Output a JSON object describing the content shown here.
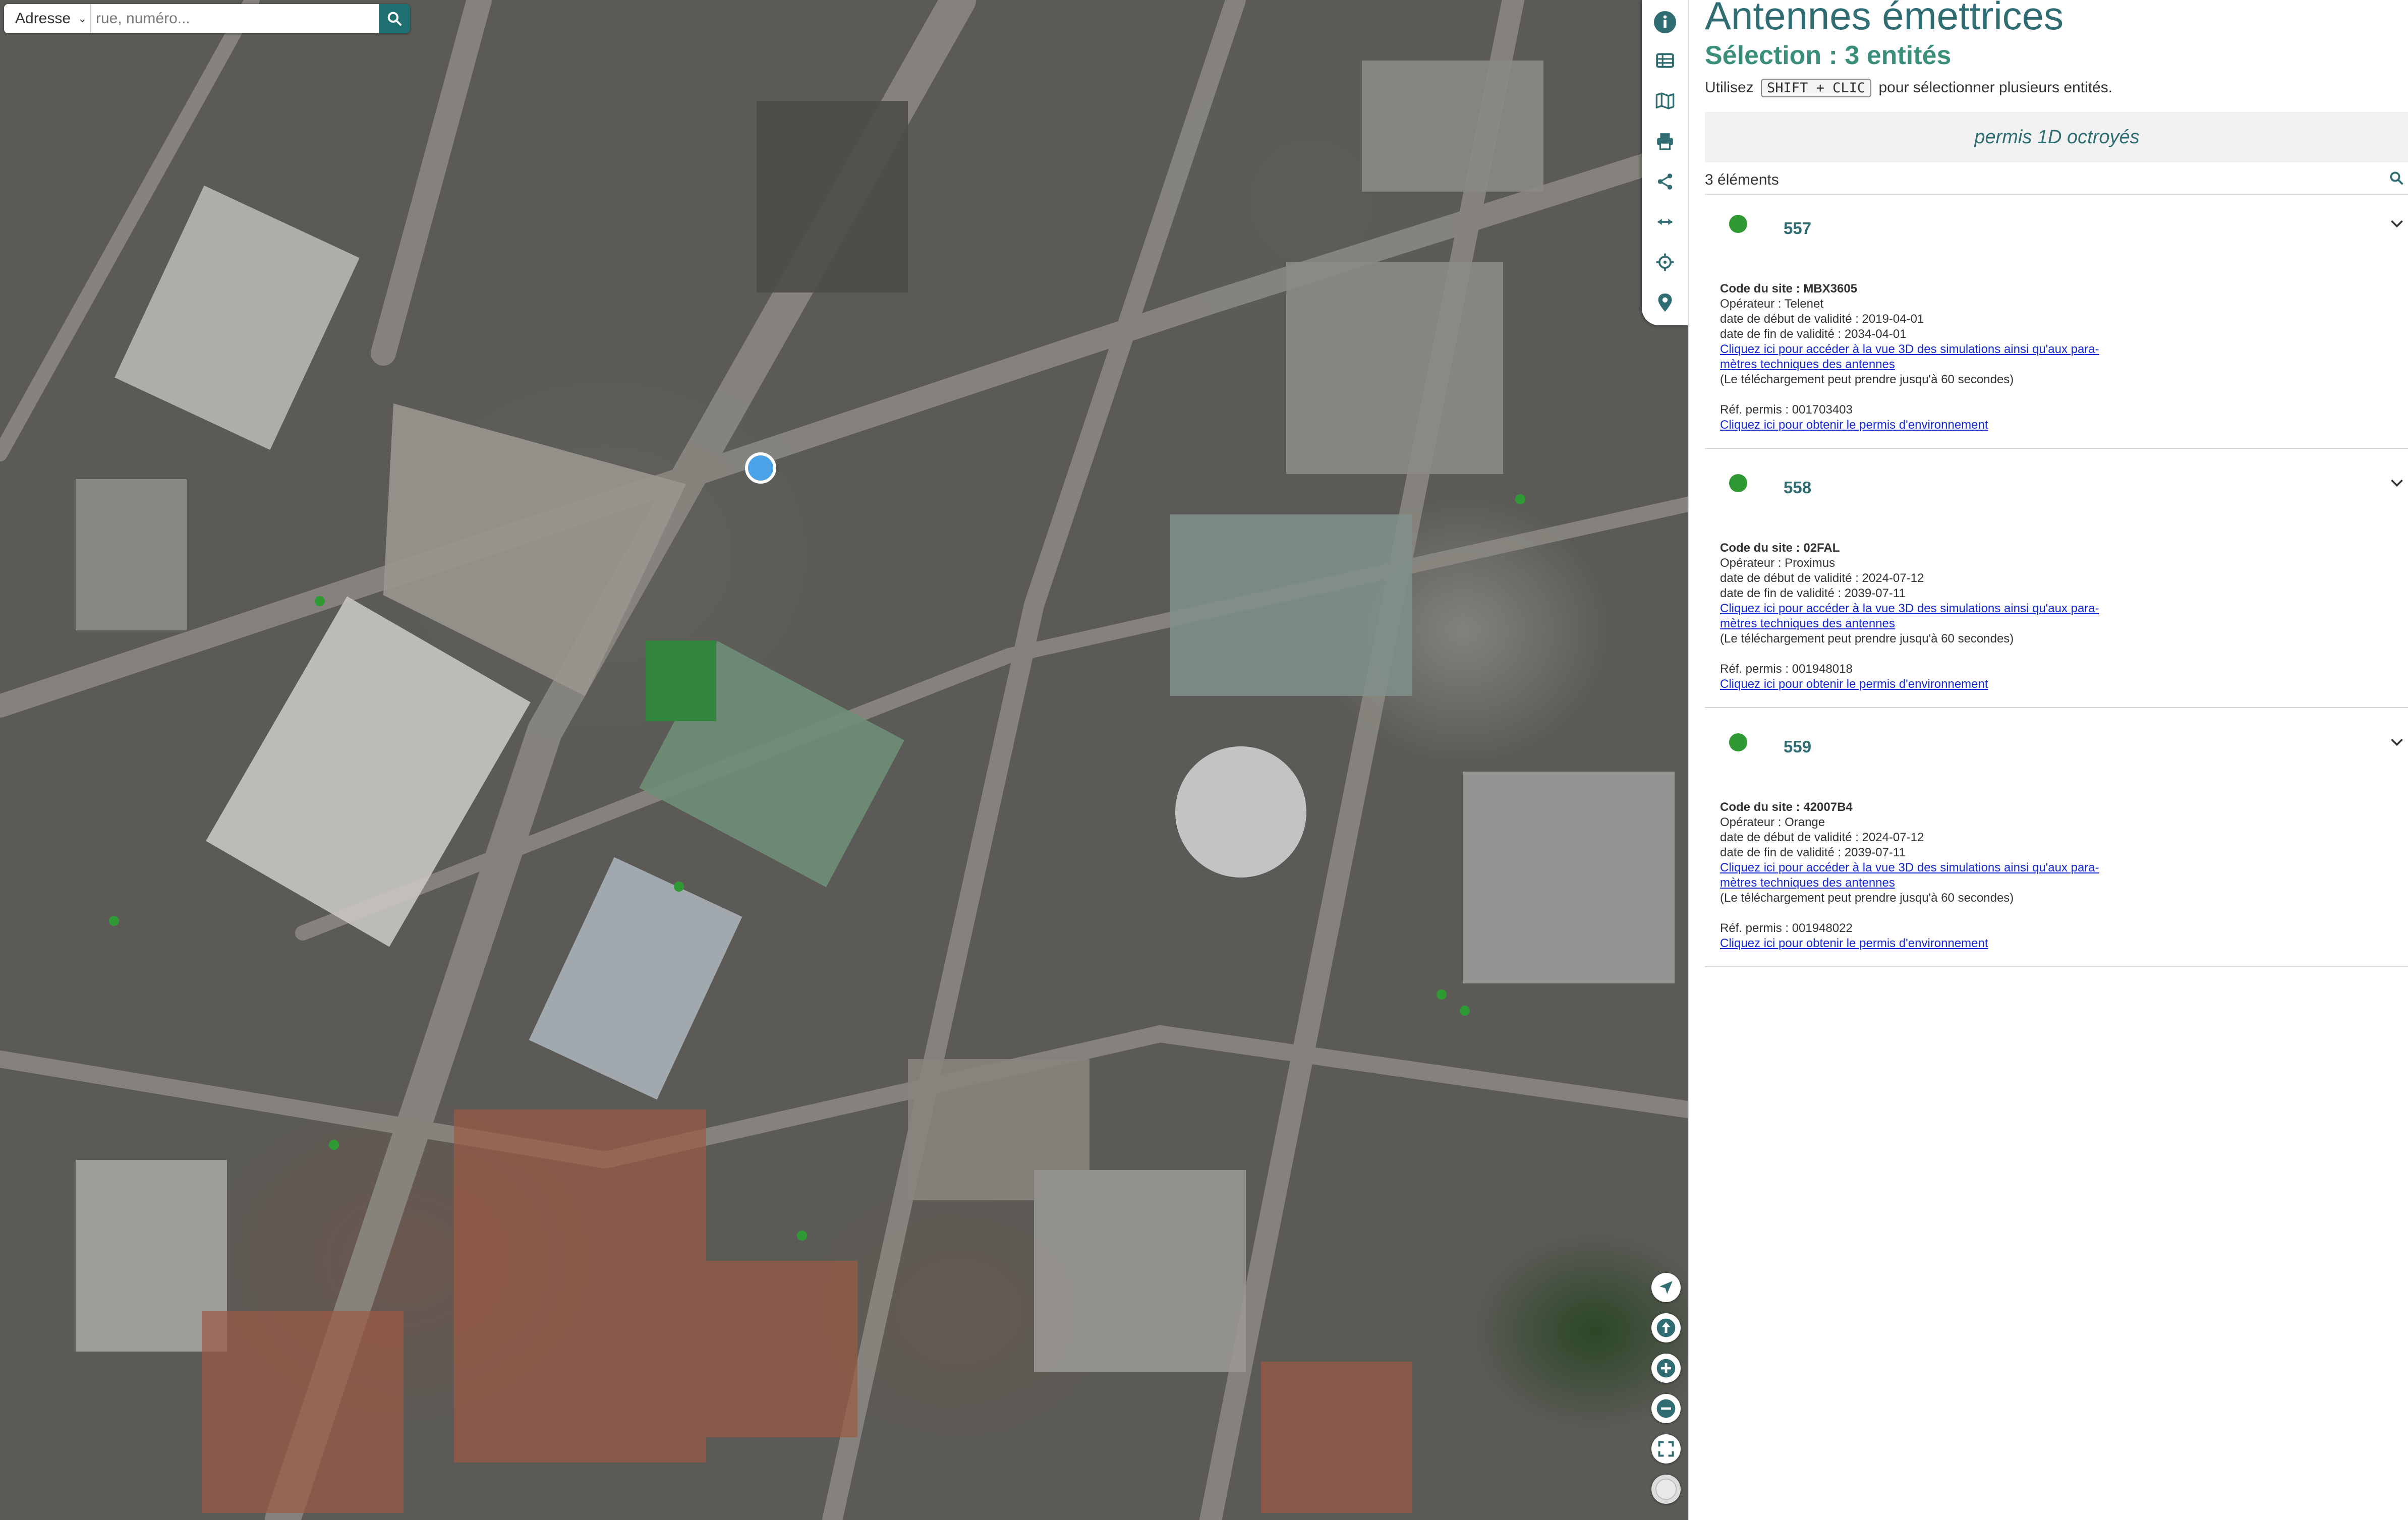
{
  "search": {
    "mode_label": "Adresse",
    "placeholder": "rue, numéro..."
  },
  "toolbar": {
    "items": [
      "info-icon",
      "table-icon",
      "map-icon",
      "print-icon",
      "share-icon",
      "measure-icon",
      "crosshair-icon",
      "pin-icon"
    ]
  },
  "map_controls": [
    "locate-icon",
    "north-arrow-icon",
    "zoom-in-icon",
    "zoom-out-icon",
    "fullscreen-icon",
    "basemap-icon"
  ],
  "panel": {
    "title": "Antennes émettrices",
    "selection": "Sélection : 3 entités",
    "hint_before": "Utilisez",
    "hint_key": "SHIFT + CLIC",
    "hint_after": "pour sélectionner plusieurs entités.",
    "group_label": "permis 1D octroyés",
    "count_label": "3 éléments",
    "entities": [
      {
        "id": "557",
        "code": "Code du site : MBX3605",
        "operator": "Opérateur : Telenet",
        "start": "date de début de validité : 2019-04-01",
        "end": "date de fin de validité : 2034-04-01",
        "link_3d_1": "Cliquez ici pour accéder à la vue 3D des simulations ainsi qu'aux para-",
        "link_3d_2": "mètres techniques des antennes",
        "download_note": "(Le téléchargement peut prendre jusqu'à 60 secondes)",
        "permit_ref": "Réf. permis : 001703403",
        "permit_link": "Cliquez ici pour obtenir le permis d'environnement"
      },
      {
        "id": "558",
        "code": "Code du site : 02FAL",
        "operator": "Opérateur : Proximus",
        "start": "date de début de validité : 2024-07-12",
        "end": "date de fin de validité : 2039-07-11",
        "link_3d_1": "Cliquez ici pour accéder à la vue 3D des simulations ainsi qu'aux para-",
        "link_3d_2": "mètres techniques des antennes",
        "download_note": "(Le téléchargement peut prendre jusqu'à 60 secondes)",
        "permit_ref": "Réf. permis : 001948018",
        "permit_link": "Cliquez ici pour obtenir le permis d'environnement"
      },
      {
        "id": "559",
        "code": "Code du site : 42007B4",
        "operator": "Opérateur : Orange",
        "start": "date de début de validité : 2024-07-12",
        "end": "date de fin de validité : 2039-07-11",
        "link_3d_1": "Cliquez ici pour accéder à la vue 3D des simulations ainsi qu'aux para-",
        "link_3d_2": "mètres techniques des antennes",
        "download_note": "(Le téléchargement peut prendre jusqu'à 60 secondes)",
        "permit_ref": "Réf. permis : 001948022",
        "permit_link": "Cliquez ici pour obtenir le permis d'environnement"
      }
    ]
  },
  "colors": {
    "accent_teal": "#2f6d73",
    "selection_green": "#3a8f7b",
    "status_dot": "#2f9a33",
    "link_blue": "#1428d6",
    "selected_marker": "#4aa3e8"
  }
}
